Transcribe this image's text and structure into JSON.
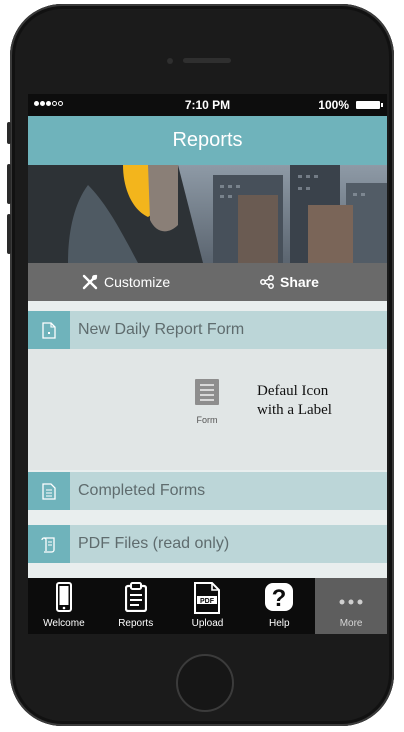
{
  "status_bar": {
    "time": "7:10 PM",
    "battery": "100%"
  },
  "header": {
    "title": "Reports"
  },
  "actions": {
    "customize": "Customize",
    "share": "Share"
  },
  "sections": [
    {
      "label": "New Daily Report Form",
      "icon": "document-icon"
    },
    {
      "label": "Completed Forms",
      "icon": "list-document-icon"
    },
    {
      "label": "PDF Files (read only)",
      "icon": "scroll-document-icon"
    }
  ],
  "form_item": {
    "caption": "Form",
    "icon": "form-icon"
  },
  "annotation": {
    "line1": "Defaul Icon",
    "line2": "with a Label"
  },
  "tabs": [
    {
      "label": "Welcome",
      "icon": "phone-icon"
    },
    {
      "label": "Reports",
      "icon": "clipboard-icon"
    },
    {
      "label": "Upload",
      "icon": "pdf-icon"
    },
    {
      "label": "Help",
      "icon": "question-icon"
    },
    {
      "label": "More",
      "icon": "more-dots-icon"
    }
  ],
  "colors": {
    "accent": "#6fb3bb",
    "section_bg": "#bcd6d8",
    "action_bar": "#6a6a6a",
    "tab_bar": "#0c0c0c"
  }
}
